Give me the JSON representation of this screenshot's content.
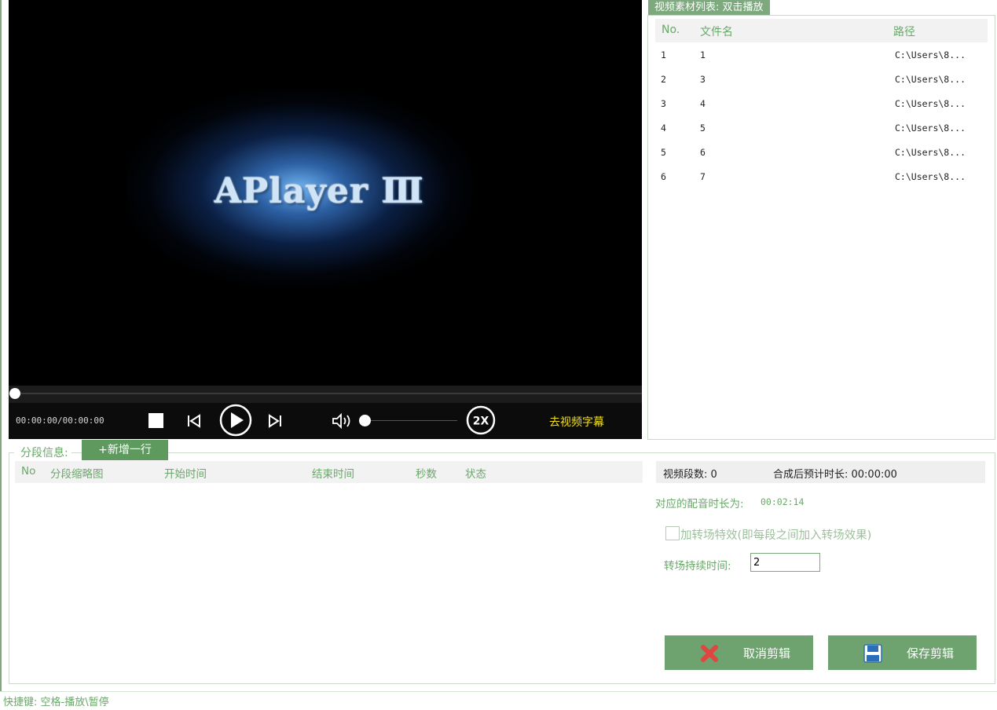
{
  "player": {
    "logo_text": "APlayer Ⅲ",
    "time": "00:00:00/00:00:00",
    "speed_label": "2X",
    "subtitle_button": "去视频字幕",
    "progress": 0,
    "volume": 0
  },
  "materials": {
    "tag": "视频素材列表: 双击播放",
    "columns": [
      "No.",
      "文件名",
      "路径"
    ],
    "rows": [
      {
        "no": "1",
        "name": "1",
        "path": "C:\\Users\\8..."
      },
      {
        "no": "2",
        "name": "3",
        "path": "C:\\Users\\8..."
      },
      {
        "no": "3",
        "name": "4",
        "path": "C:\\Users\\8..."
      },
      {
        "no": "4",
        "name": "5",
        "path": "C:\\Users\\8..."
      },
      {
        "no": "5",
        "name": "6",
        "path": "C:\\Users\\8..."
      },
      {
        "no": "6",
        "name": "7",
        "path": "C:\\Users\\8..."
      }
    ]
  },
  "segments": {
    "label": "分段信息:",
    "add_row": "+新增一行",
    "columns": [
      "No",
      "分段缩略图",
      "开始时间",
      "结束时间",
      "秒数",
      "状态"
    ]
  },
  "summary": {
    "segment_count": "视频段数: 0",
    "estimated_duration": "合成后预计时长: 00:00:00",
    "dub_label": "对应的配音时长为:",
    "dub_value": "00:02:14",
    "transition_label": "加转场特效(即每段之间加入转场效果)",
    "duration_label": "转场持续时间:",
    "duration_value": "2"
  },
  "buttons": {
    "cancel": "取消剪辑",
    "save": "保存剪辑"
  },
  "status": "快捷键: 空格-播放\\暂停",
  "colors": {
    "accent": "#6ea26e",
    "label_green": "#6aa86a",
    "subtitle_yellow": "#f3e017"
  }
}
